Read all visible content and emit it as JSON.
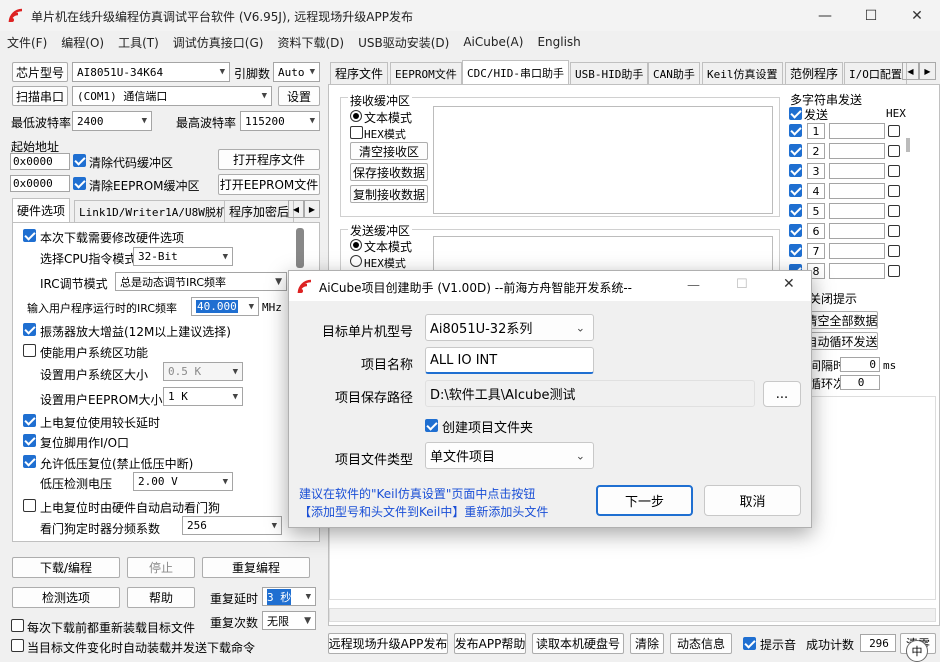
{
  "app": {
    "title": "单片机在线升级编程仿真调试平台软件 (V6.95J), 远程现场升级APP发布",
    "logo": "stc-logo-icon"
  },
  "menu": [
    "文件(F)",
    "编程(O)",
    "工具(T)",
    "调试仿真接口(G)",
    "资料下载(D)",
    "USB驱动安装(D)",
    "AiCube(A)",
    "English"
  ],
  "left": {
    "chip_label": "芯片型号",
    "chip_value": "AI8051U-34K64",
    "pin_label": "引脚数",
    "pin_value": "Auto",
    "scan_port": "扫描串口",
    "port_value": "(COM1) 通信端口",
    "settings": "设置",
    "min_baud_label": "最低波特率",
    "min_baud": "2400",
    "max_baud_label": "最高波特率",
    "max_baud": "115200",
    "start_addr_label": "起始地址",
    "addr1": "0x0000",
    "clear_code": "清除代码缓冲区",
    "open_prog": "打开程序文件",
    "addr2": "0x0000",
    "clear_eeprom": "清除EEPROM缓冲区",
    "open_eeprom": "打开EEPROM文件",
    "tabs": [
      "硬件选项",
      "Link1D/Writer1A/U8W脱机",
      "程序加密后"
    ],
    "opt_modify": "本次下载需要修改硬件选项",
    "cpu_mode_label": "选择CPU指令模式",
    "cpu_mode": "32-Bit",
    "irc_label": "IRC调节模式",
    "irc_mode": "总是动态调节IRC频率",
    "freq_label": "输入用户程序运行时的IRC频率",
    "freq_value": "40.000",
    "freq_unit": "MHz",
    "osc_gain": "振荡器放大增益(12M以上建议选择)",
    "user_sys": "使能用户系统区功能",
    "user_sys_size_label": "设置用户系统区大小",
    "user_sys_size": "0.5 K",
    "eeprom_size_label": "设置用户EEPROM大小",
    "eeprom_size": "1   K",
    "power_delay": "上电复位使用较长延时",
    "reset_io": "复位脚用作I/O口",
    "lvr": "允许低压复位(禁止低压中断)",
    "lv_label": "低压检测电压",
    "lv_value": "2.00 V",
    "wdt": "上电复位时由硬件自动启动看门狗",
    "wdt_div_label": "看门狗定时器分频系数",
    "wdt_div": "256",
    "download": "下载/编程",
    "stop": "停止",
    "reprogram": "重复编程",
    "check": "检测选项",
    "help": "帮助",
    "redelay_label": "重复延时",
    "redelay": "3 秒",
    "recount_label": "重复次数",
    "recount": "无限",
    "reload": "每次下载前都重新装载目标文件",
    "autosend": "当目标文件变化时自动装载并发送下载命令"
  },
  "right_tabs": [
    "程序文件",
    "EEPROM文件",
    "CDC/HID-串口助手",
    "USB-HID助手",
    "CAN助手",
    "Keil仿真设置",
    "范例程序",
    "I/O口配置"
  ],
  "serial": {
    "recv_title": "接收缓冲区",
    "text_mode": "文本模式",
    "hex_mode": "HEX模式",
    "clear_recv": "清空接收区",
    "save_recv": "保存接收数据",
    "copy_recv": "复制接收数据",
    "send_title": "发送缓冲区",
    "send_text_mode": "文本模式",
    "send_hex_mode": "HEX模式",
    "multi_title": "多字符串发送",
    "send_col": "发送",
    "hex_col": "HEX",
    "rows": [
      "1",
      "2",
      "3",
      "4",
      "5",
      "6",
      "7",
      "8"
    ],
    "close_tip": "关闭提示",
    "clear_all": "清空全部数据",
    "auto_loop": "自动循环发送",
    "interval_label": "间隔时间",
    "interval": "0",
    "interval_unit": "ms",
    "loop_label": "循环次数",
    "loop": "0"
  },
  "bottom": {
    "publish": "远程现场升级APP发布",
    "publish_help": "发布APP帮助",
    "read_disk": "读取本机硬盘号",
    "clear": "清除",
    "dynamic": "动态信息",
    "beep": "提示音",
    "success_label": "成功计数",
    "success": "296",
    "clear2": "清零"
  },
  "dialog": {
    "title": "AiCube项目创建助手 (V1.00D) --前海方舟智能开发系统--",
    "mcu_label": "目标单片机型号",
    "mcu": "Ai8051U-32系列",
    "name_label": "项目名称",
    "name": "ALL IO INT",
    "path_label": "项目保存路径",
    "path": "D:\\软件工具\\AIcube测试",
    "browse": "...",
    "create_folder": "创建项目文件夹",
    "type_label": "项目文件类型",
    "type": "单文件项目",
    "hint1": "建议在软件的\"Keil仿真设置\"页面中点击按钮",
    "hint2": "【添加型号和头文件到Keil中】重新添加头文件",
    "next": "下一步",
    "cancel": "取消"
  }
}
